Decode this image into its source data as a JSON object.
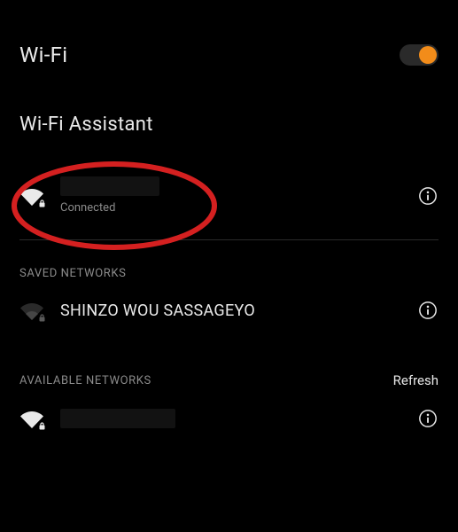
{
  "header": {
    "title": "Wi-Fi",
    "toggle_on": true
  },
  "assistant": {
    "label": "Wi-Fi Assistant"
  },
  "connected": {
    "name": "",
    "status": "Connected"
  },
  "saved": {
    "header": "SAVED NETWORKS",
    "items": [
      {
        "name": "SHINZO WOU SASSAGEYO"
      }
    ]
  },
  "available": {
    "header": "AVAILABLE NETWORKS",
    "refresh_label": "Refresh",
    "items": [
      {
        "name": ""
      }
    ]
  },
  "colors": {
    "accent": "#f28c1a",
    "annotation": "#d42020"
  }
}
